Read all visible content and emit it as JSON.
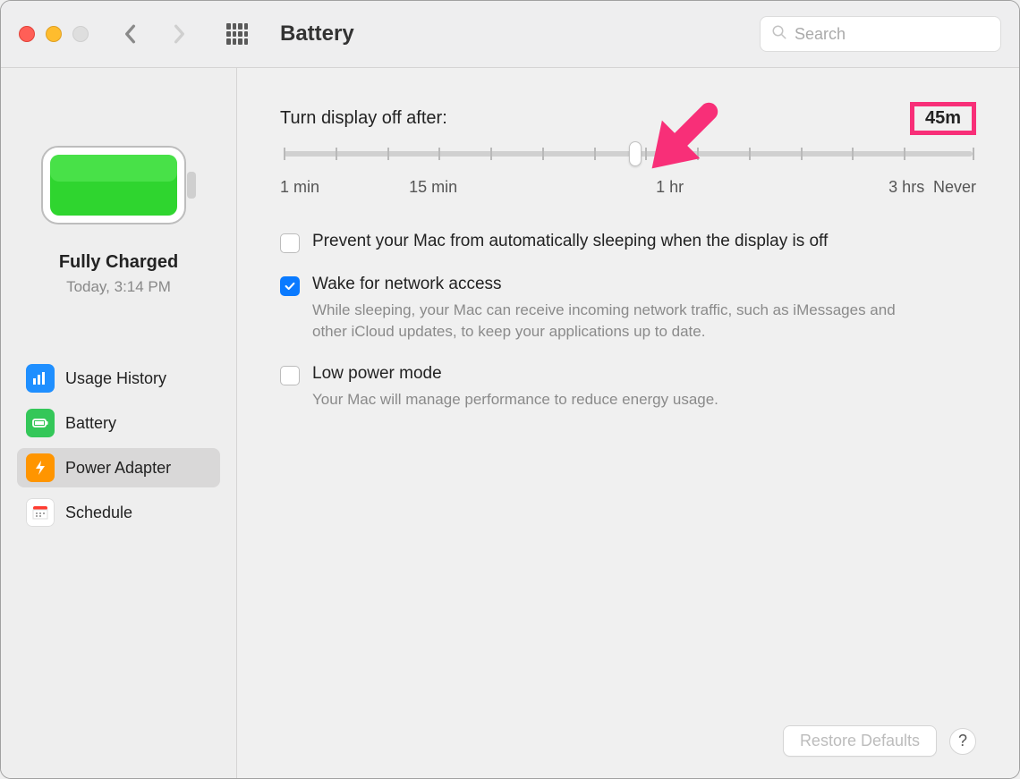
{
  "window": {
    "title": "Battery",
    "search_placeholder": "Search"
  },
  "sidebar": {
    "status_title": "Fully Charged",
    "status_sub": "Today, 3:14 PM",
    "items": [
      {
        "id": "usage-history",
        "label": "Usage History",
        "icon": "bars-icon",
        "color": "blue"
      },
      {
        "id": "battery",
        "label": "Battery",
        "icon": "battery-icon",
        "color": "green"
      },
      {
        "id": "power-adapter",
        "label": "Power Adapter",
        "icon": "bolt-icon",
        "color": "orange",
        "active": true
      },
      {
        "id": "schedule",
        "label": "Schedule",
        "icon": "calendar-icon",
        "color": "white"
      }
    ]
  },
  "main": {
    "slider": {
      "label": "Turn display off after:",
      "value_display": "45m",
      "value_pct": 51,
      "ticks_labels": {
        "min1": "1 min",
        "min15": "15 min",
        "hr1": "1 hr",
        "hr3": "3 hrs",
        "never": "Never"
      }
    },
    "options": [
      {
        "id": "prevent-sleep",
        "label": "Prevent your Mac from automatically sleeping when the display is off",
        "checked": false,
        "desc": ""
      },
      {
        "id": "wake-network",
        "label": "Wake for network access",
        "checked": true,
        "desc": "While sleeping, your Mac can receive incoming network traffic, such as iMessages and other iCloud updates, to keep your applications up to date."
      },
      {
        "id": "low-power",
        "label": "Low power mode",
        "checked": false,
        "desc": "Your Mac will manage performance to reduce energy usage."
      }
    ],
    "restore_label": "Restore Defaults",
    "help_label": "?"
  },
  "annotation": {
    "arrow_color": "#f82f78",
    "box_color": "#f82f78"
  }
}
